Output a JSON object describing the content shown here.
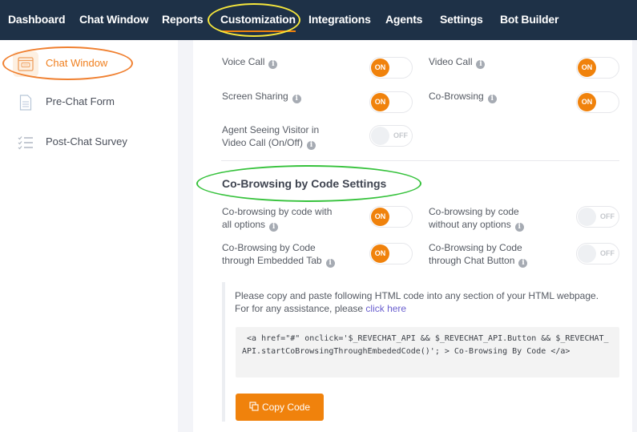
{
  "topnav": {
    "items": [
      {
        "label": "Dashboard"
      },
      {
        "label": "Chat Window"
      },
      {
        "label": "Reports"
      },
      {
        "label": "Customization",
        "active": true
      },
      {
        "label": "Integrations"
      },
      {
        "label": "Agents"
      },
      {
        "label": "Settings"
      },
      {
        "label": "Bot Builder"
      }
    ]
  },
  "sidebar": {
    "items": [
      {
        "label": "Chat Window",
        "icon": "chat-window-icon",
        "active": true
      },
      {
        "label": "Pre-Chat Form",
        "icon": "document-icon"
      },
      {
        "label": "Post-Chat Survey",
        "icon": "checklist-icon"
      }
    ]
  },
  "settings": {
    "voice_call": {
      "label": "Voice Call",
      "state": "ON"
    },
    "video_call": {
      "label": "Video Call",
      "state": "ON"
    },
    "screen_sharing": {
      "label": "Screen Sharing",
      "state": "ON"
    },
    "co_browsing": {
      "label": "Co-Browsing",
      "state": "ON"
    },
    "agent_seeing_visitor": {
      "label_line1": "Agent Seeing Visitor in",
      "label_line2": "Video Call (On/Off)",
      "state": "OFF"
    }
  },
  "cobrowse_code": {
    "title": "Co-Browsing by Code Settings",
    "all_options": {
      "label_line1": "Co-browsing by code with",
      "label_line2": "all options",
      "state": "ON"
    },
    "without_options": {
      "label_line1": "Co-browsing by code",
      "label_line2": "without any options",
      "state": "OFF"
    },
    "embedded_tab": {
      "label_line1": "Co-Browsing by Code",
      "label_line2": "through Embedded Tab",
      "state": "ON"
    },
    "chat_button": {
      "label_line1": "Co-Browsing by Code",
      "label_line2": "through Chat Button",
      "state": "OFF"
    }
  },
  "instructions": {
    "line1": "Please copy and paste following HTML code into any section of your HTML webpage.",
    "line2_prefix": "For for any assistance, please ",
    "link": "click here"
  },
  "code_snippet": " <a href=\"#\" onclick='$_REVECHAT_API && $_REVECHAT_API.Button && $_REVECHAT_API.startCoBrowsingThroughEmbededCode()'; > Co-Browsing By Code </a>",
  "copy_button": {
    "label": "Copy Code",
    "icon": "copy-icon"
  },
  "colors": {
    "accent": "#f0820c",
    "nav_bg": "#1e3147",
    "link": "#6a5fcf"
  }
}
